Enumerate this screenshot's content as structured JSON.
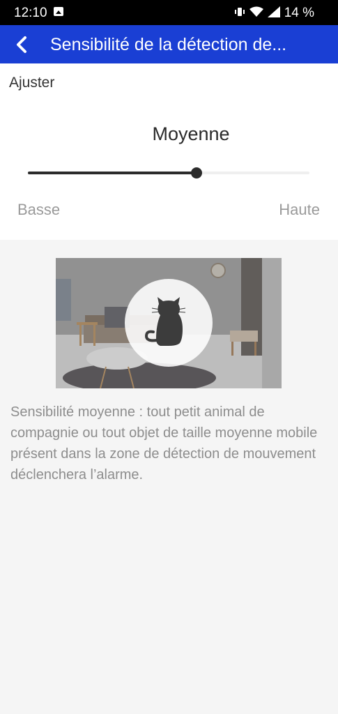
{
  "status_bar": {
    "time": "12:10",
    "battery": "14 %",
    "icons": [
      "gallery-icon",
      "vibrate-icon",
      "wifi-icon",
      "signal-icon"
    ]
  },
  "app_bar": {
    "title": "Sensibilité de la détection de...",
    "back_icon": "chevron-left-icon",
    "color": "#1a3fd4"
  },
  "adjust": {
    "label": "Ajuster",
    "level_value": "Moyenne",
    "slider_fraction": 0.6,
    "min_label": "Basse",
    "max_label": "Haute"
  },
  "illustration": {
    "icon": "cat-icon",
    "scene": "living-room-photo"
  },
  "description": "Sensibilité moyenne : tout petit animal de compagnie ou tout objet de taille moyenne mobile présent dans la zone de détection de mouvement déclenchera l’alarme."
}
